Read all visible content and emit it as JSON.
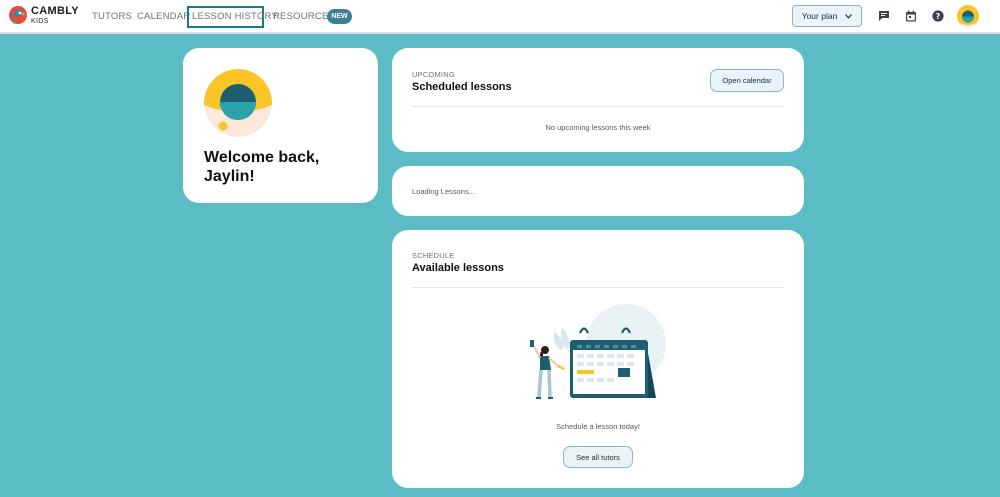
{
  "header": {
    "logo": {
      "line1": "CAMBLY",
      "line2": "KIDS"
    },
    "nav": [
      {
        "label": "TUTORS"
      },
      {
        "label": "CALENDAR"
      },
      {
        "label": "LESSON HISTORY",
        "active": true
      },
      {
        "label": "RESOURCES"
      }
    ],
    "badge": "NEW",
    "plan_label": "Your plan",
    "icons": [
      "chat-icon",
      "calendar-icon",
      "help-icon",
      "avatar"
    ]
  },
  "welcome": {
    "title": "Welcome back, Jaylin!"
  },
  "upcoming": {
    "eyebrow": "UPCOMING",
    "title": "Scheduled lessons",
    "button": "Open calendar",
    "empty_text": "No upcoming lessons this week"
  },
  "loading": {
    "text": "Loading Lessons..."
  },
  "schedule": {
    "eyebrow": "SCHEDULE",
    "title": "Available lessons",
    "prompt": "Schedule a lesson today!",
    "button": "See all tutors"
  },
  "colors": {
    "background": "#5bbcc6",
    "accent": "#1c7a82",
    "badge": "#3d7f96",
    "yellow": "#f9c528"
  }
}
